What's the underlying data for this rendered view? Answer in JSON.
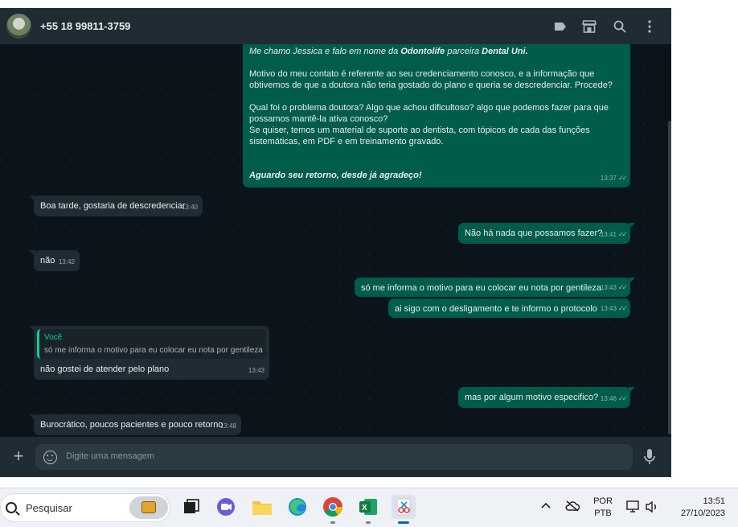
{
  "header": {
    "contact": "+55 18 99811-3759",
    "icons": [
      "label-icon",
      "store-icon",
      "search-icon",
      "menu-icon"
    ]
  },
  "messages": {
    "m1": {
      "line1_a": "Me chamo Jessica e falo em nome da ",
      "line1_b": "Odontolife",
      "line1_c": " parceira ",
      "line1_d": "Dental Uni.",
      "p2": "Motivo do meu contato é referente ao seu credenciamento conosco, e a informação que obtivemos de que a doutora não teria gostado do plano e queria se descredenciar. Procede?",
      "p3": "Qual foi o problema doutora? Algo que achou dificultoso? algo que podemos fazer para que possamos mantê-la ativa conosco?",
      "p4": "Se quiser, temos um material de suporte ao dentista, com tópicos de cada das funções sistemáticas, em PDF e em treinamento gravado.",
      "p5": "Aguardo seu retorno, desde já agradeço!",
      "time": "13:37"
    },
    "m2": {
      "text": "Boa tarde, gostaria de descredenciar",
      "time": "13:40"
    },
    "m3": {
      "text": "Não há nada que possamos fazer?",
      "time": "13:41"
    },
    "m4": {
      "text": "não",
      "time": "13:42"
    },
    "m5": {
      "text": "só me informa o motivo para eu colocar eu nota por gentileza",
      "time": "13:43"
    },
    "m6": {
      "text": "ai sigo com o desligamento e te informo o protocolo",
      "time": "13:43"
    },
    "m7": {
      "quote_author": "Você",
      "quote_text": "só me informa o motivo para eu colocar eu nota por gentileza",
      "text": "não gostei de atender pelo plano",
      "time": "13:43"
    },
    "m8": {
      "text": "mas por algum motivo especifico?",
      "time": "13:46"
    },
    "m9": {
      "text": "Burocrático, poucos pacientes e pouco retorno",
      "time": "13:48"
    }
  },
  "composer": {
    "placeholder": "Digite uma mensagem"
  },
  "taskbar": {
    "search_label": "Pesquisar",
    "language_top": "POR",
    "language_bottom": "PTB",
    "clock_time": "13:51",
    "clock_date": "27/10/2023"
  },
  "colors": {
    "chat_bg": "#0b141a",
    "header_bg": "#202c33",
    "outgoing": "#005c4b",
    "incoming": "#202c33",
    "quote_accent": "#06cf9c"
  }
}
